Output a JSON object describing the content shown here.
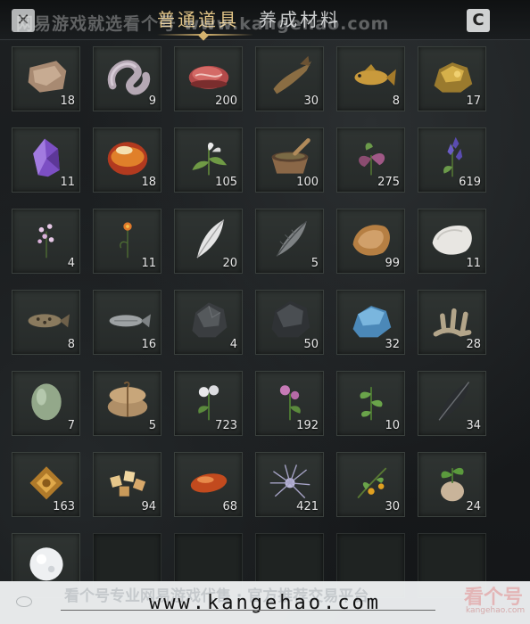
{
  "header": {
    "tabs": [
      {
        "label": "普通道具",
        "active": true
      },
      {
        "label": "养成材料",
        "active": false
      }
    ],
    "left_button_icon": "close-icon",
    "right_button_label": "C",
    "watermark": "网易游戏就选看个号 www.kangehao.com"
  },
  "items": [
    {
      "name": "leather-scrap",
      "count": "18"
    },
    {
      "name": "tangled-intestine",
      "count": "9"
    },
    {
      "name": "raw-meat",
      "count": "200"
    },
    {
      "name": "dried-fish",
      "count": "30"
    },
    {
      "name": "golden-carp",
      "count": "8"
    },
    {
      "name": "gold-ore",
      "count": "17"
    },
    {
      "name": "purple-crystal",
      "count": "11"
    },
    {
      "name": "red-jade-stone",
      "count": "18"
    },
    {
      "name": "white-herb",
      "count": "105"
    },
    {
      "name": "herb-mortar",
      "count": "100"
    },
    {
      "name": "purple-flower",
      "count": "275"
    },
    {
      "name": "lavender",
      "count": "619"
    },
    {
      "name": "small-pink-flower",
      "count": "4"
    },
    {
      "name": "orange-flower",
      "count": "11"
    },
    {
      "name": "white-feather",
      "count": "20"
    },
    {
      "name": "grey-feather",
      "count": "5"
    },
    {
      "name": "brown-fur",
      "count": "99"
    },
    {
      "name": "white-fur",
      "count": "11"
    },
    {
      "name": "spotted-fish",
      "count": "8"
    },
    {
      "name": "grey-fish",
      "count": "16"
    },
    {
      "name": "black-ore",
      "count": "4"
    },
    {
      "name": "dark-ore",
      "count": "50"
    },
    {
      "name": "blue-crystal",
      "count": "32"
    },
    {
      "name": "coral-bone",
      "count": "28"
    },
    {
      "name": "green-gourd",
      "count": "7"
    },
    {
      "name": "tied-bag",
      "count": "5"
    },
    {
      "name": "white-flowers",
      "count": "723"
    },
    {
      "name": "pink-flowers",
      "count": "192"
    },
    {
      "name": "green-herb",
      "count": "10"
    },
    {
      "name": "black-feather",
      "count": "34"
    },
    {
      "name": "golden-ornament",
      "count": "163"
    },
    {
      "name": "candy-pieces",
      "count": "94"
    },
    {
      "name": "red-bean",
      "count": "68"
    },
    {
      "name": "spider-lily",
      "count": "421"
    },
    {
      "name": "fruit-branch",
      "count": "30"
    },
    {
      "name": "sprouting-bulb",
      "count": "24"
    },
    {
      "name": "snowball",
      "count": ""
    }
  ],
  "footer": {
    "url": "www.kangehao.com",
    "faint_text": "看个号专业网易游戏代售 · 官方推荐交易平台",
    "logo_text": "看个号",
    "logo_sub": "kangehao.com"
  }
}
